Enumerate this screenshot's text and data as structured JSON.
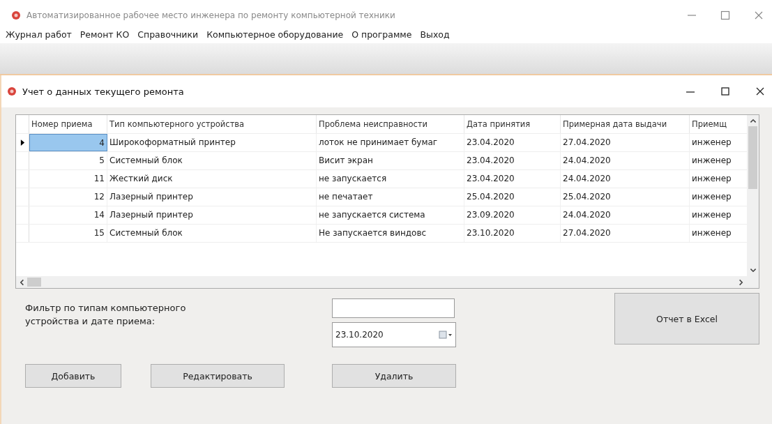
{
  "window": {
    "title": "Автоматизированное  рабочее место  инженера по ремонту компьютерной техники"
  },
  "menu": [
    "Журнал работ",
    "Ремонт КО",
    "Справочники",
    "Компьютерное оборудование",
    "О программе",
    "Выход"
  ],
  "child_window": {
    "title": "Учет о данных текущего ремонта"
  },
  "table": {
    "columns": [
      "Номер приема",
      "Тип компьютерного устройства",
      "Проблема неисправности",
      "Дата принятия",
      "Примерная дата выдачи",
      "Приемщ"
    ],
    "rows": [
      {
        "selected": true,
        "cells": [
          "4",
          "Широкоформатный принтер",
          "лоток не принимает бумаг",
          "23.04.2020",
          "27.04.2020",
          "инженер"
        ]
      },
      {
        "selected": false,
        "cells": [
          "5",
          "Системный блок",
          "Висит экран",
          "23.04.2020",
          "24.04.2020",
          "инженер"
        ]
      },
      {
        "selected": false,
        "cells": [
          "11",
          "Жесткий диск",
          "не запускается",
          "23.04.2020",
          "24.04.2020",
          "инженер"
        ]
      },
      {
        "selected": false,
        "cells": [
          "12",
          "Лазерный принтер",
          "не печатает",
          "25.04.2020",
          "25.04.2020",
          "инженер"
        ]
      },
      {
        "selected": false,
        "cells": [
          "14",
          "Лазерный принтер",
          "не запускается система",
          "23.09.2020",
          "24.04.2020",
          "инженер"
        ]
      },
      {
        "selected": false,
        "cells": [
          "15",
          "Системный блок",
          "Не запускается виндовс",
          "23.10.2020",
          "27.04.2020",
          "инженер"
        ]
      }
    ]
  },
  "filter": {
    "label": "Фильтр по типам компьютерного устройства и дате приема:",
    "date": "23.10.2020"
  },
  "buttons": {
    "report": "Отчет в Excel",
    "add": "Добавить",
    "edit": "Редактировать",
    "delete": "Удалить"
  }
}
